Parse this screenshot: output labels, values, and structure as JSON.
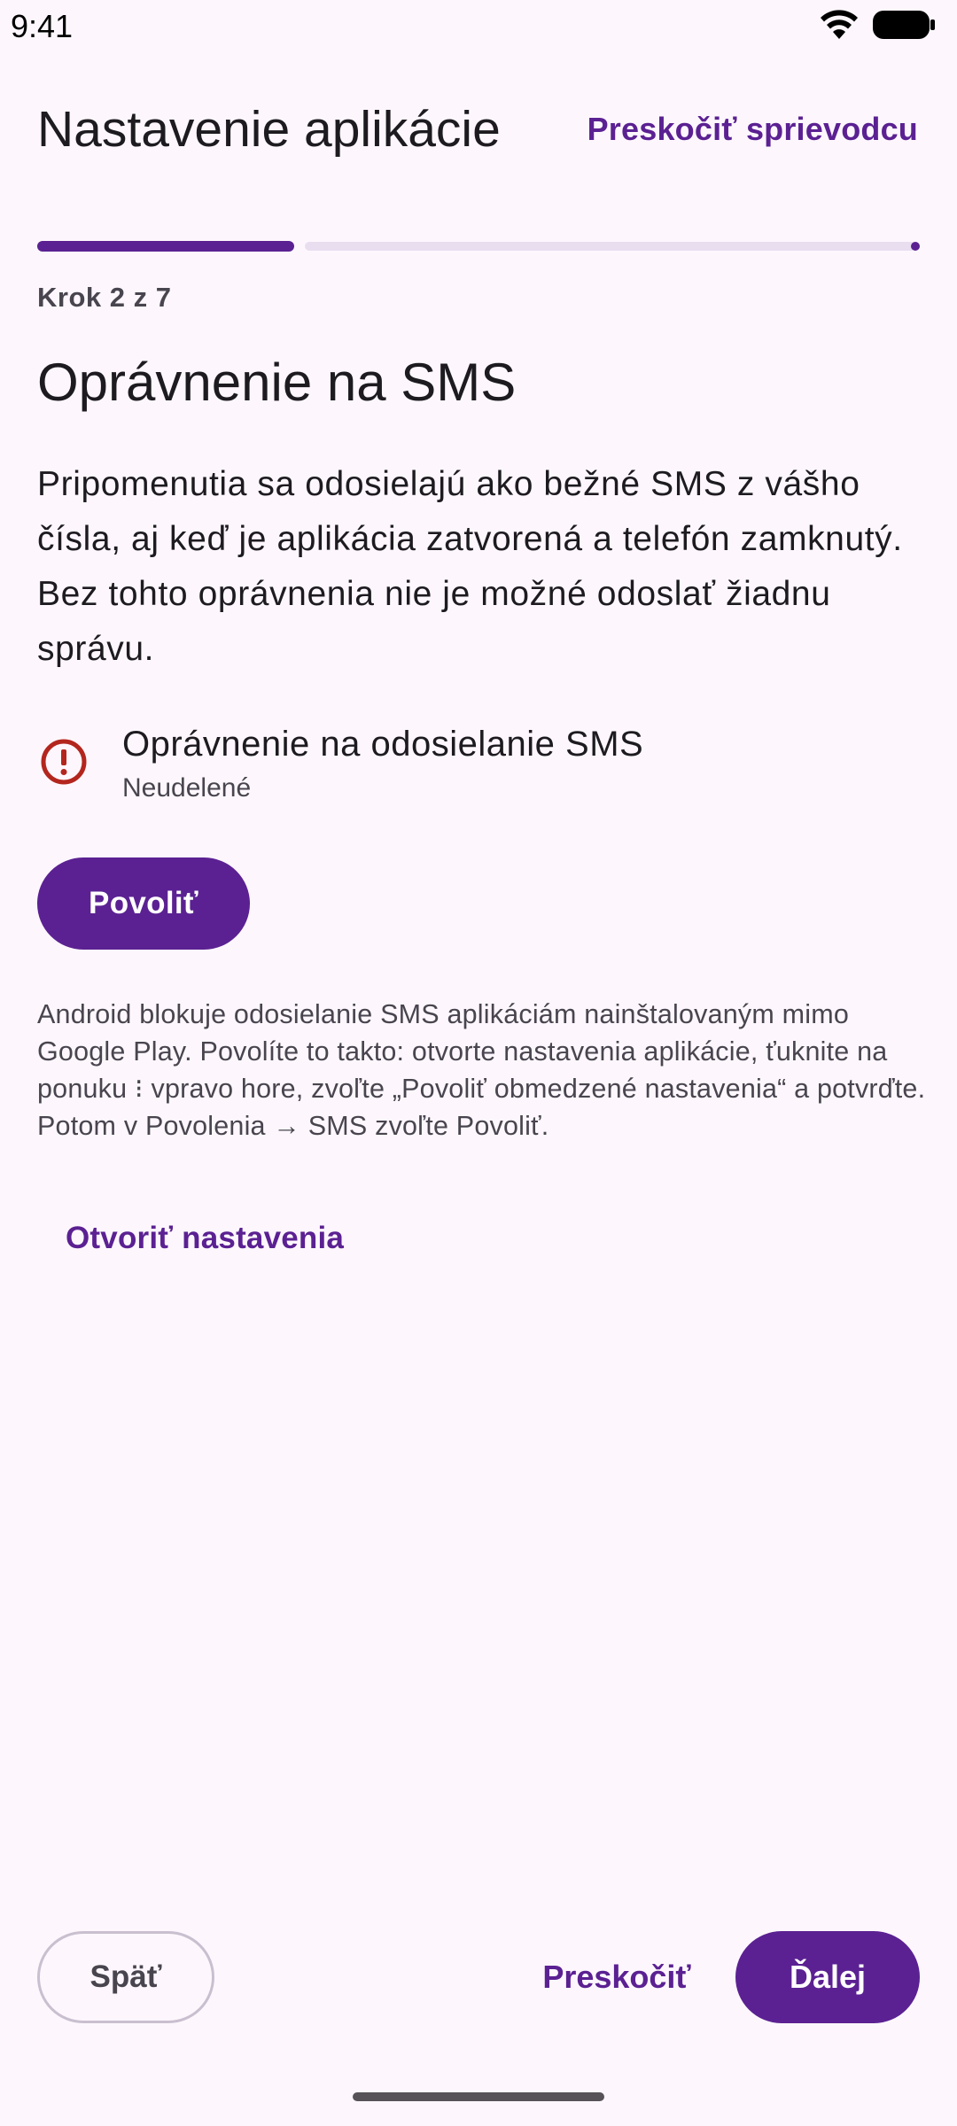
{
  "status_bar": {
    "time": "9:41",
    "icons": [
      "wifi-icon",
      "battery-icon"
    ]
  },
  "header": {
    "title": "Nastavenie aplikácie",
    "skip_wizard_label": "Preskočiť sprievodcu"
  },
  "progress": {
    "current_step": 2,
    "total_steps": 7,
    "step_label": "Krok 2 z 7"
  },
  "step": {
    "title": "Oprávnenie na SMS",
    "description": "Pripomenutia sa odosielajú ako bežné SMS z vášho čísla, aj keď je aplikácia zatvorená a telefón zamknutý. Bez tohto oprávnenia nie je možné odoslať žiadnu správu.",
    "permission": {
      "icon": "error-icon",
      "name": "Oprávnenie na odosielanie SMS",
      "status": "Neudelené"
    },
    "allow_label": "Povoliť",
    "hint": "Android blokuje odosielanie SMS aplikáciám nainštalovaným mimo Google Play. Povolíte to takto: otvorte nastavenia aplikácie, ťuknite na ponuku ⁝ vpravo hore, zvoľte „Povoliť obmedzené nastavenia“ a potvrďte. Potom v Povolenia → SMS zvoľte Povoliť.",
    "open_settings_label": "Otvoriť nastavenia"
  },
  "footer": {
    "back_label": "Späť",
    "skip_label": "Preskočiť",
    "next_label": "Ďalej"
  },
  "colors": {
    "primary": "#5B2192",
    "background": "#FDF7FD",
    "error": "#B3261E",
    "track": "#E9DEF0"
  }
}
